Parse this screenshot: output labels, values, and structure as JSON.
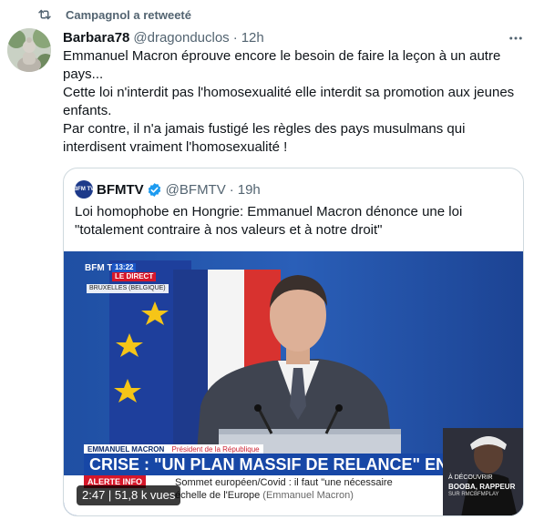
{
  "retweet": {
    "label": "Campagnol a retweeté"
  },
  "tweet": {
    "author_name": "Barbara78",
    "author_handle": "@dragonduclos",
    "separator": "·",
    "time": "12h",
    "text_lines": [
      "Emmanuel Macron éprouve encore le besoin de faire la leçon à un autre pays...",
      "Cette loi n'interdit pas l'homosexualité elle interdit sa promotion aux jeunes enfants.",
      "Par contre, il n'a jamais fustigé les règles des pays musulmans qui interdisent vraiment l'homosexualité !"
    ]
  },
  "quoted_tweet": {
    "avatar_text": "BFM TV",
    "author_name": "BFMTV",
    "author_handle": "@BFMTV",
    "separator": "·",
    "time": "19h",
    "text_lines": [
      "Loi homophobe en Hongrie: Emmanuel Macron dénonce une loi",
      "\"totalement contraire à nos valeurs et à notre droit\""
    ],
    "video": {
      "channel_logo": "BFM TV.",
      "clock": "13:22",
      "live_label": "LE DIRECT",
      "location": "BRUXELLES (BELGIQUE)",
      "speaker": "EMMANUEL MACRON",
      "speaker_role": "Président de la République",
      "headline": "CRISE : \"UN PLAN MASSIF DE RELANCE\" EN EUROPE",
      "ticker_tag": "ALERTE INFO",
      "ticker_line1": "Sommet européen/Covid : il faut \"une nécessaire",
      "ticker_line2": "échelle de l'Europe",
      "ticker_source": "(Emmanuel Macron)",
      "promo_label": "À DÉCOUVRIR",
      "promo_title": "BOOBA, RAPPEUR",
      "promo_sub": "SUR RMCBFMPLAY",
      "duration": "2:47 | 51,8 k vues"
    }
  },
  "colors": {
    "text": "#0f1419",
    "secondary": "#536471",
    "verified": "#1d9bf0",
    "border": "#cfd9de",
    "headline_bg": "#1747a6",
    "alert_red": "#d6172a"
  },
  "icons": [
    "retweet-icon",
    "more-icon",
    "verified-badge-icon"
  ]
}
